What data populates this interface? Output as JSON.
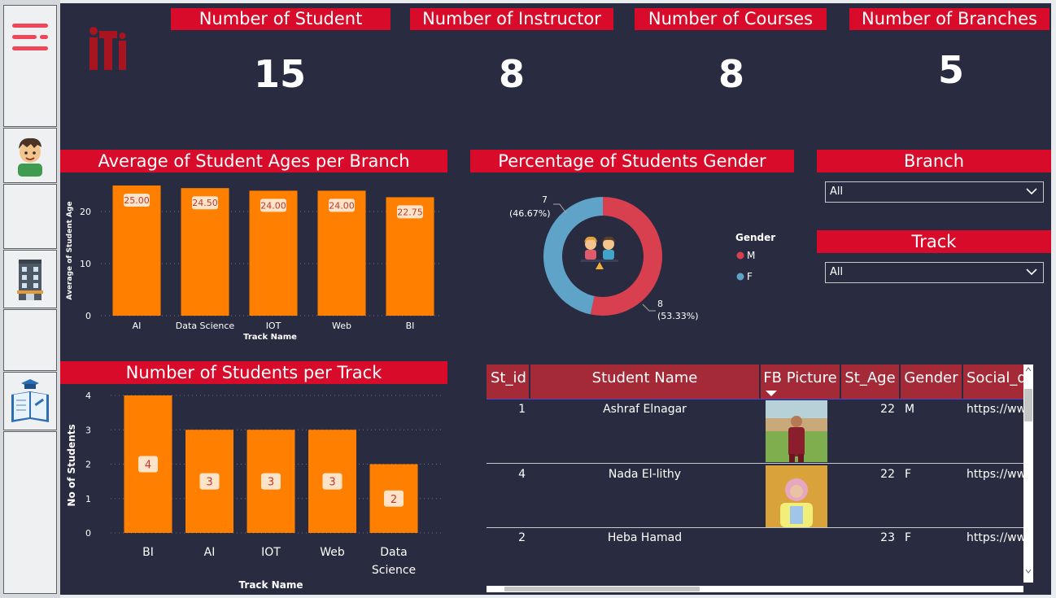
{
  "kpis": [
    {
      "title": "Number of Student",
      "value": "15"
    },
    {
      "title": "Number of Instructor",
      "value": "8"
    },
    {
      "title": "Number of Courses",
      "value": "8"
    },
    {
      "title": "Number of Branches",
      "value": "5"
    }
  ],
  "sections": {
    "ages_title": "Average of Student Ages per Branch",
    "gender_title": "Percentage of Students Gender",
    "track_title": "Number of Students per Track",
    "branch_filter_title": "Branch",
    "track_filter_title": "Track"
  },
  "filters": {
    "branch_value": "All",
    "track_value": "All"
  },
  "colors": {
    "accent_red": "#d80b2a",
    "bar_orange": "#ff8000",
    "background": "#292b40",
    "male": "#d8404f",
    "female": "#5fa3c8",
    "table_header": "#a52a38"
  },
  "icons": [
    "hamburger-menu-icon",
    "student-avatar-icon",
    "building-icon",
    "book-graduation-icon",
    "iti-logo",
    "students-gender-icon"
  ],
  "chart_data": [
    {
      "type": "bar",
      "title": "Average of Student Ages per Branch",
      "xlabel": "Track Name",
      "ylabel": "Average of Student Age",
      "categories": [
        "AI",
        "Data Science",
        "IOT",
        "Web",
        "BI"
      ],
      "values": [
        25.0,
        24.5,
        24.0,
        24.0,
        22.75
      ],
      "data_labels": [
        "25.00",
        "24.50",
        "24.00",
        "24.00",
        "22.75"
      ],
      "yticks": [
        "0",
        "10",
        "20"
      ],
      "ylim": [
        0,
        25
      ],
      "grid": true
    },
    {
      "type": "pie",
      "title": "Percentage of Students Gender",
      "legend_title": "Gender",
      "legend_position": "right",
      "slices": [
        {
          "label": "M",
          "value": 8,
          "display": "8",
          "percent": "(53.33%)"
        },
        {
          "label": "F",
          "value": 7,
          "display": "7",
          "percent": "(46.67%)"
        }
      ]
    },
    {
      "type": "bar",
      "title": "Number of Students per Track",
      "xlabel": "Track Name",
      "ylabel": "No of Students",
      "categories": [
        "BI",
        "AI",
        "IOT",
        "Web",
        "Data Science"
      ],
      "values": [
        4,
        3,
        3,
        3,
        2
      ],
      "yticks": [
        "0",
        "1",
        "2",
        "3",
        "4"
      ],
      "ylim": [
        0,
        4
      ],
      "grid": true
    }
  ],
  "table": {
    "columns": [
      "St_id",
      "Student Name",
      "FB Picture",
      "St_Age",
      "Gender",
      "Social_d"
    ],
    "rows": [
      {
        "id": "1",
        "name": "Ashraf Elnagar",
        "age": "22",
        "gender": "M",
        "social": "https://ww"
      },
      {
        "id": "4",
        "name": "Nada El-lithy",
        "age": "22",
        "gender": "F",
        "social": "https://ww"
      },
      {
        "id": "2",
        "name": "Heba Hamad",
        "age": "23",
        "gender": "F",
        "social": "https://ww"
      }
    ]
  }
}
